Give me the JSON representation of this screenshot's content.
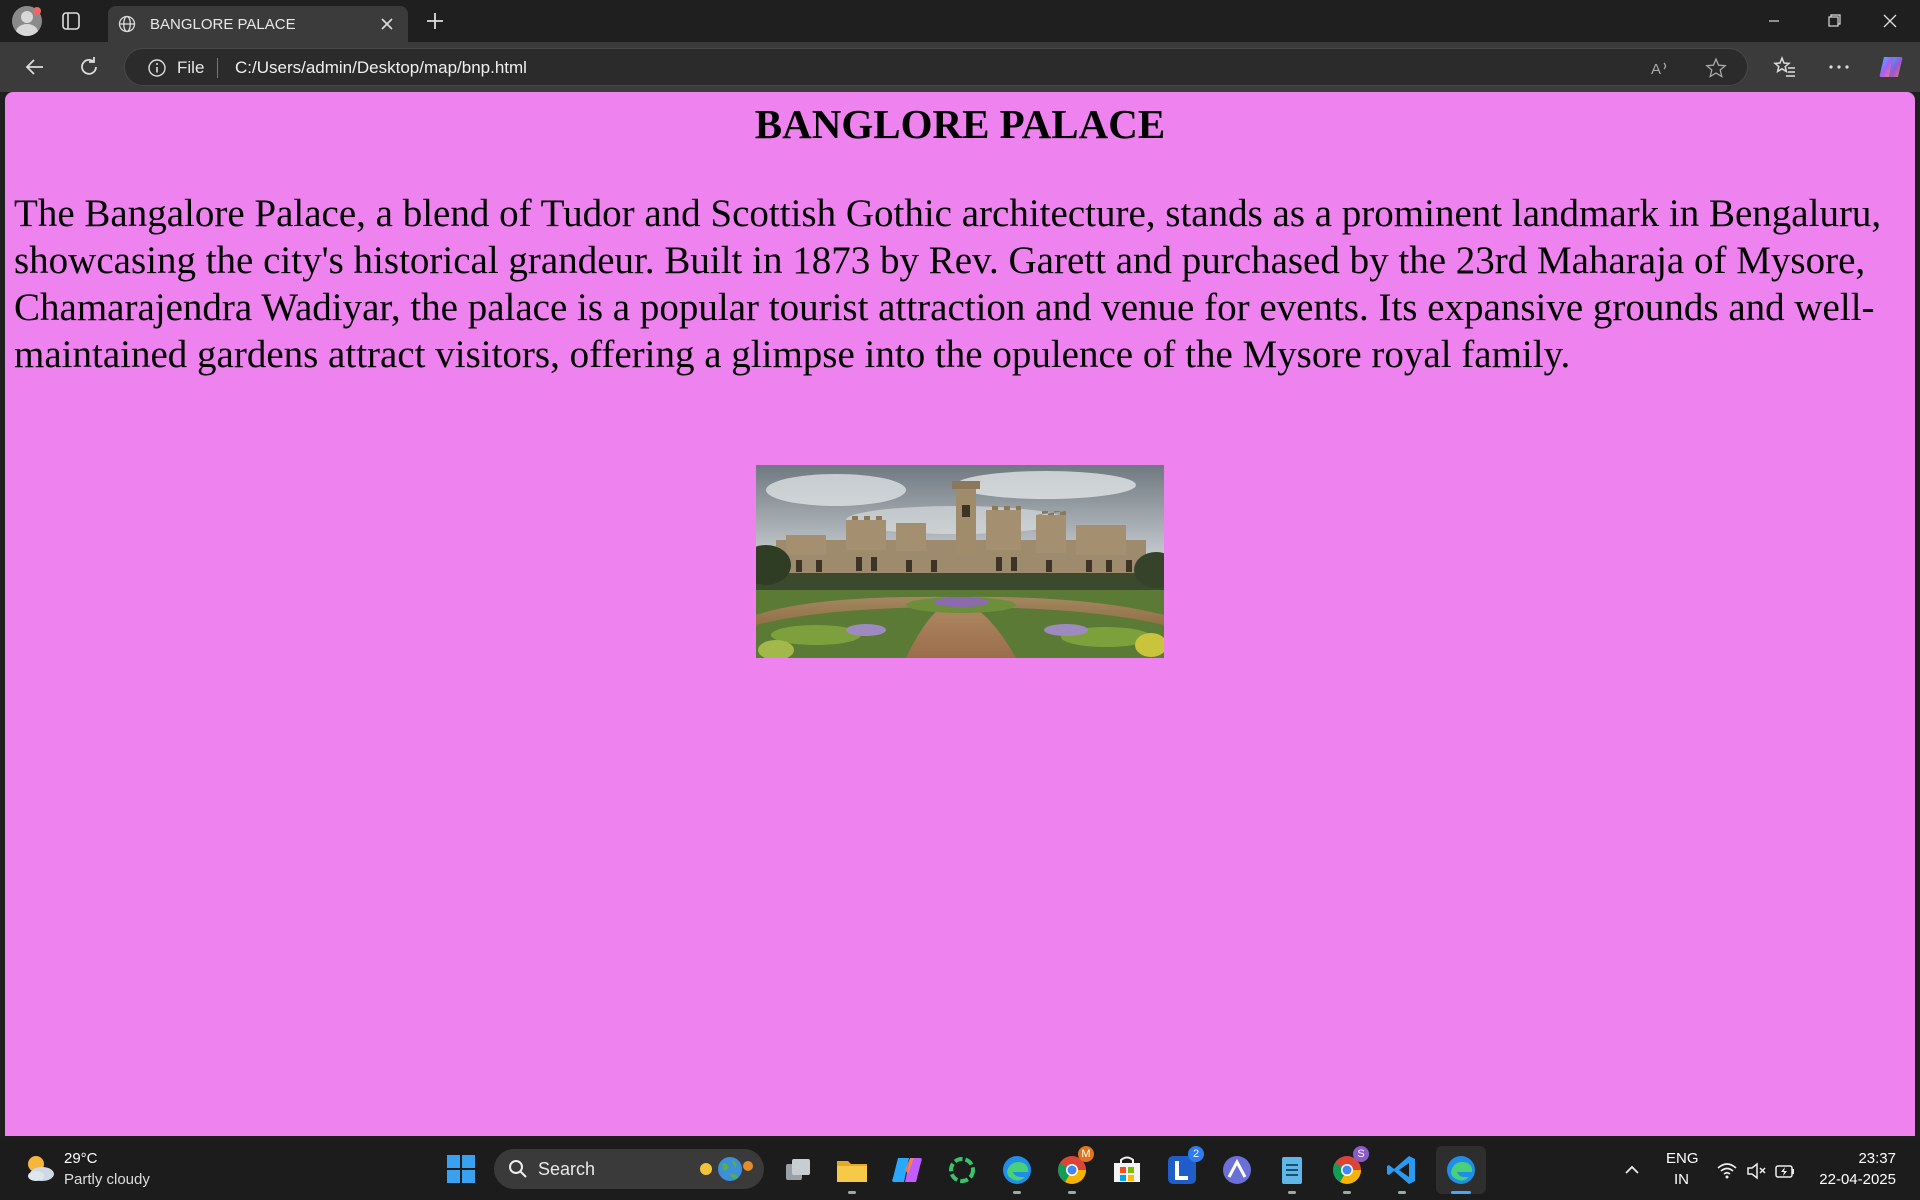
{
  "browser": {
    "tab_title": "BANGLORE PALACE",
    "address_scheme": "File",
    "address_url": "C:/Users/admin/Desktop/map/bnp.html"
  },
  "page": {
    "background": "#ee82ee",
    "heading": "BANGLORE PALACE",
    "paragraph": "The Bangalore Palace, a blend of Tudor and Scottish Gothic architecture, stands as a prominent landmark in Bengaluru, showcasing the city's historical grandeur. Built in 1873 by Rev. Garett and purchased by the 23rd Maharaja of Mysore, Chamarajendra Wadiyar, the palace is a popular tourist attraction and venue for events. Its expansive grounds and well-maintained gardens attract visitors, offering a glimpse into the opulence of the Mysore royal family.",
    "image": "palace-photo"
  },
  "taskbar": {
    "weather_temp": "29°C",
    "weather_condition": "Partly cloudy",
    "search_label": "Search",
    "apps": [
      {
        "name": "task-view-icon"
      },
      {
        "name": "file-explorer-icon"
      },
      {
        "name": "copilot-icon"
      },
      {
        "name": "sync-app-icon"
      },
      {
        "name": "edge-icon"
      },
      {
        "name": "chrome-profile-m-icon",
        "badge": "M"
      },
      {
        "name": "microsoft-store-icon"
      },
      {
        "name": "lens-app-icon",
        "badge": "2"
      },
      {
        "name": "arc-app-icon"
      },
      {
        "name": "notepad-icon"
      },
      {
        "name": "chrome-profile-s-icon",
        "badge": "S"
      },
      {
        "name": "vscode-icon"
      },
      {
        "name": "edge-active-icon"
      }
    ],
    "lang_line1": "ENG",
    "lang_line2": "IN",
    "time": "23:37",
    "date": "22-04-2025"
  }
}
